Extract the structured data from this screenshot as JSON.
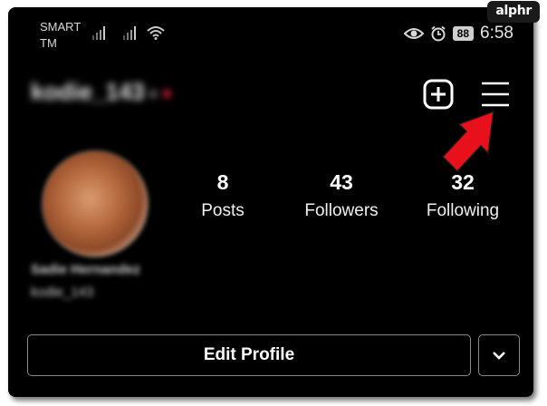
{
  "watermark": "alphr",
  "status_bar": {
    "carrier_line1": "SMART",
    "carrier_line2": "TM",
    "battery": "88",
    "time": "6:58",
    "icons": [
      "signal-icon",
      "signal-icon",
      "wifi-icon",
      "eye-icon",
      "alarm-icon",
      "battery-icon"
    ]
  },
  "header": {
    "username": "kodie_143",
    "live_dot_color": "#e0203c",
    "icons": [
      "add-post-icon",
      "menu-icon"
    ],
    "annotation": "red-arrow-icon"
  },
  "profile": {
    "stats": [
      {
        "num": "8",
        "label": "Posts"
      },
      {
        "num": "43",
        "label": "Followers"
      },
      {
        "num": "32",
        "label": "Following"
      }
    ],
    "bio_name": "Sadie Hernandez",
    "bio_user": "kodie_143"
  },
  "actions": {
    "edit_label": "Edit Profile",
    "dropdown_icon": "chevron-down-icon"
  },
  "colors": {
    "background": "#000000",
    "arrow": "#e8101a",
    "button_border": "#8a8a8a"
  }
}
